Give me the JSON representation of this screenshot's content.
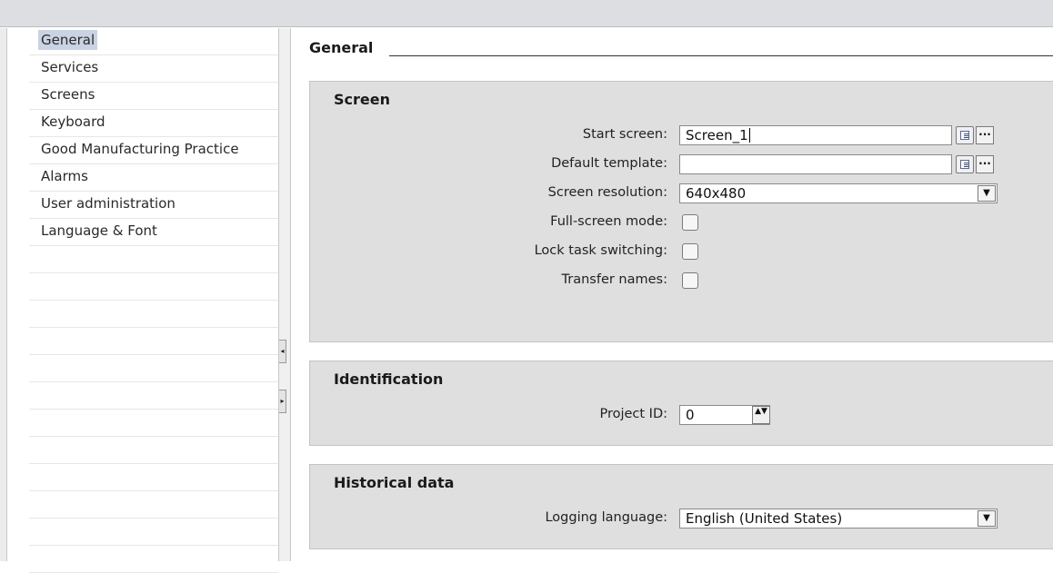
{
  "nav": {
    "items": [
      {
        "label": "General",
        "selected": true
      },
      {
        "label": "Services"
      },
      {
        "label": "Screens"
      },
      {
        "label": "Keyboard"
      },
      {
        "label": "Good Manufacturing Practice"
      },
      {
        "label": "Alarms"
      },
      {
        "label": "User administration"
      },
      {
        "label": "Language & Font"
      }
    ]
  },
  "main": {
    "title": "General",
    "screen": {
      "title": "Screen",
      "start_screen_label": "Start screen:",
      "start_screen_value": "Screen_1",
      "default_template_label": "Default template:",
      "default_template_value": "",
      "screen_resolution_label": "Screen resolution:",
      "screen_resolution_value": "640x480",
      "fullscreen_label": "Full-screen mode:",
      "lock_task_label": "Lock task switching:",
      "transfer_names_label": "Transfer names:"
    },
    "identification": {
      "title": "Identification",
      "project_id_label": "Project ID:",
      "project_id_value": "0"
    },
    "historical": {
      "title": "Historical data",
      "logging_language_label": "Logging language:",
      "logging_language_value": "English (United States)"
    }
  },
  "icons": {
    "list": "list-icon",
    "ellipsis": "...",
    "dropdown": "▼",
    "spin": "▲▼",
    "splitter_left": "◂",
    "splitter_right": "▸"
  },
  "colors": {
    "selected_bg": "#c9d3e3",
    "group_bg": "#dfdfdf",
    "topbar_bg": "#dcdee2"
  }
}
